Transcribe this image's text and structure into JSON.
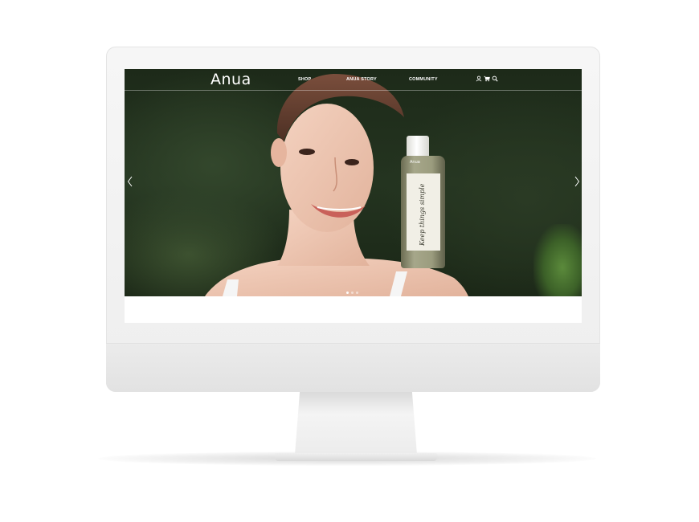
{
  "brand": {
    "logo_text": "Anua",
    "accent_color": "#ffffff"
  },
  "nav": {
    "items": [
      {
        "label": "SHOP"
      },
      {
        "label": "ANUA STORY"
      },
      {
        "label": "COMMUNITY"
      }
    ],
    "icons": [
      "user-icon",
      "cart-icon",
      "search-icon"
    ]
  },
  "hero": {
    "slide_count": 3,
    "active_slide": 1,
    "product": {
      "brand": "Anua",
      "script_text": "Keep things simple"
    }
  }
}
